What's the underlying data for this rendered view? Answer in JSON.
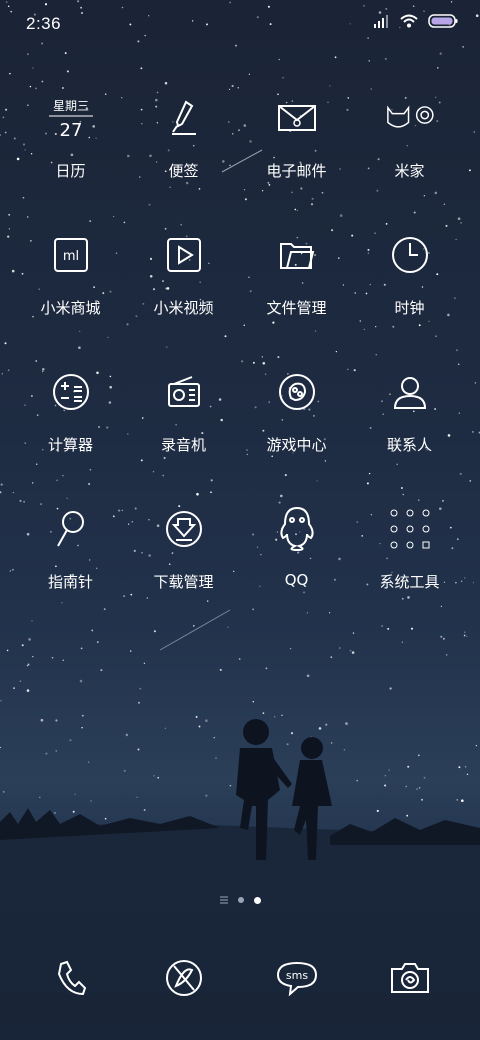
{
  "status_bar": {
    "time": "2:36"
  },
  "apps": [
    [
      {
        "name": "calendar",
        "label": "日历",
        "weekday": "星期三",
        "day": "27"
      },
      {
        "name": "notes",
        "label": "便签"
      },
      {
        "name": "email",
        "label": "电子邮件"
      },
      {
        "name": "mi-home",
        "label": "米家"
      }
    ],
    [
      {
        "name": "mi-store",
        "label": "小米商城",
        "icon_text": "ml"
      },
      {
        "name": "mi-video",
        "label": "小米视频"
      },
      {
        "name": "file-manager",
        "label": "文件管理"
      },
      {
        "name": "clock",
        "label": "时钟"
      }
    ],
    [
      {
        "name": "calculator",
        "label": "计算器"
      },
      {
        "name": "recorder",
        "label": "录音机"
      },
      {
        "name": "game-center",
        "label": "游戏中心"
      },
      {
        "name": "contacts",
        "label": "联系人"
      }
    ],
    [
      {
        "name": "compass",
        "label": "指南针"
      },
      {
        "name": "downloads",
        "label": "下载管理"
      },
      {
        "name": "qq",
        "label": "QQ"
      },
      {
        "name": "system-tools",
        "label": "系统工具"
      }
    ]
  ],
  "page_indicator": {
    "pages": 3,
    "current": 3
  },
  "dock": [
    {
      "name": "phone"
    },
    {
      "name": "browser"
    },
    {
      "name": "messages",
      "icon_text": "sms"
    },
    {
      "name": "camera"
    }
  ]
}
